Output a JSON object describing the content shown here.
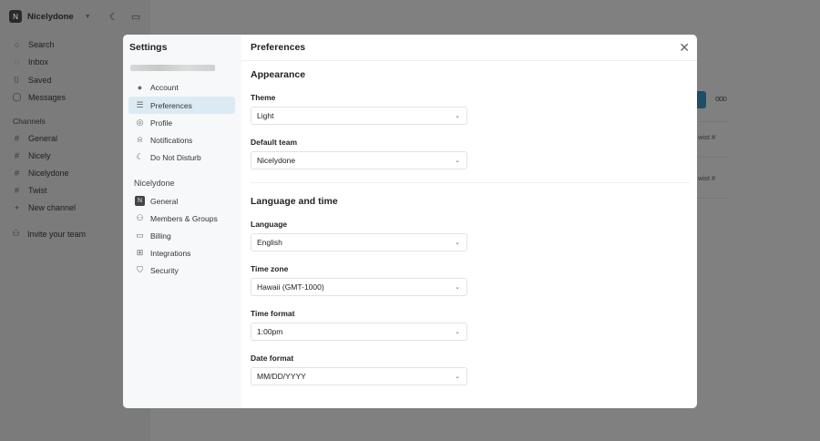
{
  "app": {
    "team": "Nicelydone",
    "team_initial": "N",
    "nav": [
      {
        "label": "Search",
        "icon": "search-icon"
      },
      {
        "label": "Inbox",
        "icon": "inbox-icon"
      },
      {
        "label": "Saved",
        "icon": "bookmark-icon"
      },
      {
        "label": "Messages",
        "icon": "message-icon"
      }
    ],
    "channels_title": "Channels",
    "channels": [
      "General",
      "Nicely",
      "Nicelydone",
      "Twist"
    ],
    "new_channel": "New channel",
    "invite": "Invite your team",
    "bg_tags": [
      "wist #",
      "wist #"
    ],
    "more": "ooo"
  },
  "settings": {
    "title": "Settings",
    "personal": [
      {
        "label": "Account",
        "icon": "avatar-icon"
      },
      {
        "label": "Preferences",
        "icon": "sliders-icon"
      },
      {
        "label": "Profile",
        "icon": "profile-icon"
      },
      {
        "label": "Notifications",
        "icon": "bell-icon"
      },
      {
        "label": "Do Not Disturb",
        "icon": "moon-icon"
      }
    ],
    "team_title": "Nicelydone",
    "team": [
      {
        "label": "General",
        "icon": "team-logo-icon"
      },
      {
        "label": "Members & Groups",
        "icon": "users-icon"
      },
      {
        "label": "Billing",
        "icon": "card-icon"
      },
      {
        "label": "Integrations",
        "icon": "integrations-icon"
      },
      {
        "label": "Security",
        "icon": "shield-icon"
      }
    ]
  },
  "prefs": {
    "title": "Preferences",
    "appearance": "Appearance",
    "lang_time": "Language and time",
    "fields": [
      {
        "label": "Theme",
        "value": "Light"
      },
      {
        "label": "Default team",
        "value": "Nicelydone"
      },
      {
        "label": "Language",
        "value": "English"
      },
      {
        "label": "Time zone",
        "value": "Hawaii (GMT-1000)"
      },
      {
        "label": "Time format",
        "value": "1:00pm"
      },
      {
        "label": "Date format",
        "value": "MM/DD/YYYY"
      }
    ]
  }
}
